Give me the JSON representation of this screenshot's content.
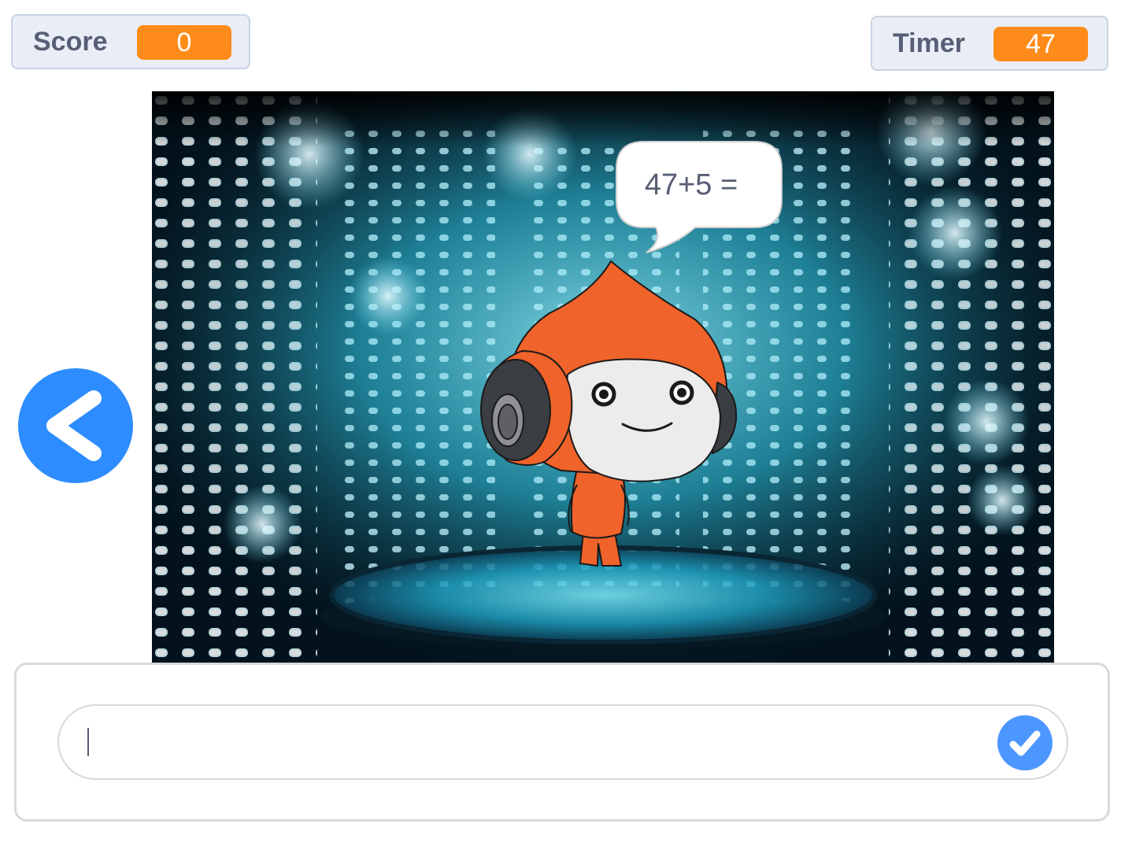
{
  "score": {
    "label": "Score",
    "value": "0"
  },
  "timer": {
    "label": "Timer",
    "value": "47"
  },
  "stage": {
    "speech_bubble": "47+5 =",
    "backdrop": "spotlight-stage",
    "sprite": "pico-character"
  },
  "answer": {
    "input_value": "",
    "submit_icon": "check-icon"
  },
  "nav": {
    "back_icon": "chevron-left-icon"
  },
  "colors": {
    "monitor_value": "#ff8c1a",
    "back_button": "#2d8cff",
    "submit_button": "#4c97ff",
    "label_text": "#575e75"
  }
}
